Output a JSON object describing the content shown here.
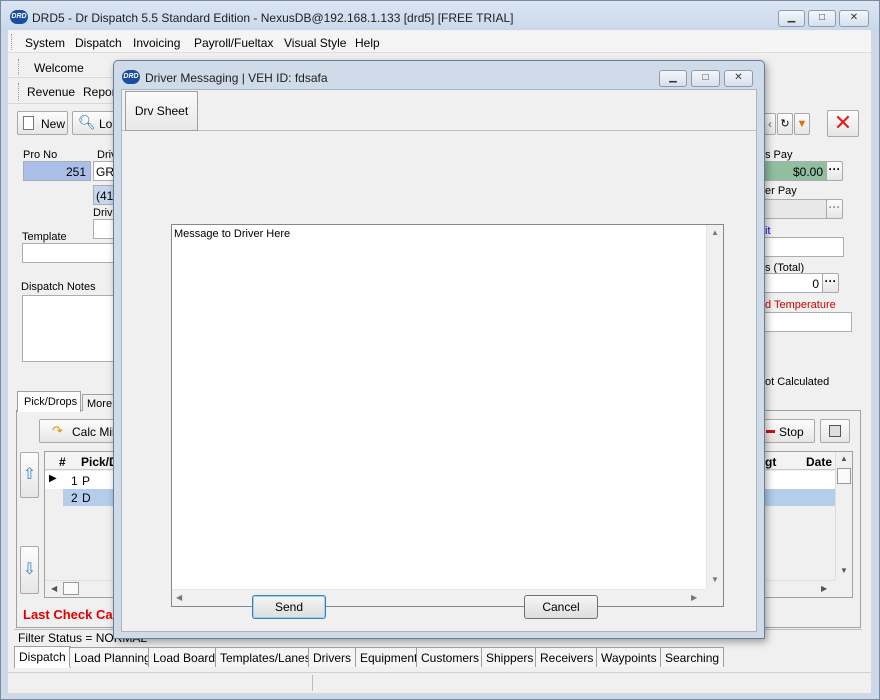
{
  "window": {
    "logo_text": "DRD",
    "title": "DRD5 - Dr Dispatch 5.5 Standard Edition - NexusDB@192.168.1.133 [drd5] [FREE TRIAL]"
  },
  "menu": [
    "System",
    "Dispatch",
    "Invoicing",
    "Payroll/Fueltax",
    "Visual Style",
    "Help"
  ],
  "toolbar": {
    "welcome": "Welcome",
    "revenue": "Revenue",
    "reports": "Repor",
    "new": "New",
    "load": "Lo"
  },
  "form": {
    "pro_no_label": "Pro No",
    "pro_no_value": "251",
    "driver_label": "Driv",
    "driver_value": "GRI",
    "phone_value": "(417",
    "driver2_label": "Drive",
    "template_label": "Template",
    "dispatch_notes_label": "Dispatch Notes",
    "pay_label": "s Pay",
    "pay_value": "$0.00",
    "other_pay_label": "er Pay",
    "unit_label": "it",
    "total_label": "s (Total)",
    "total_value": "0",
    "temp_label": "d Temperature",
    "not_calc": "ot Calculated",
    "last_check": "Last Check Call",
    "filter_status": "Filter Status = NORMAL"
  },
  "subtabs": [
    "Pick/Drops",
    "More..."
  ],
  "grid": {
    "calc_miles": "Calc Miles",
    "stop": "Stop",
    "headers": [
      "#",
      "Pick/D",
      "gt",
      "Date"
    ],
    "rows": [
      {
        "num": "1",
        "type": "P"
      },
      {
        "num": "2",
        "type": "D"
      }
    ]
  },
  "bottom_tabs": [
    "Dispatch",
    "Load Planning",
    "Load Board",
    "Templates/Lanes",
    "Drivers",
    "Equipment",
    "Customers",
    "Shippers",
    "Receivers",
    "Waypoints",
    "Searching"
  ],
  "dialog": {
    "logo_text": "DRD",
    "title": "Driver Messaging | VEH ID: fdsafa",
    "tab": "Drv Sheet",
    "message_text": "Message to Driver Here",
    "send": "Send",
    "cancel": "Cancel"
  },
  "colors": {
    "pro_no_bg": "#a9bfe8",
    "pay_bg": "#8fbf9f",
    "temp_label": "#cc0000",
    "last_check": "#e00000",
    "unit_label": "#0000cc",
    "close_x": "#e02020",
    "row_highlight": "#b3cdea"
  },
  "icons": [
    "minimize-icon",
    "maximize-icon",
    "close-icon",
    "new-doc-icon",
    "search-load-icon",
    "calc-icon",
    "up-arrow-icon",
    "down-arrow-icon",
    "save-icon",
    "refresh-icon",
    "filter-icon"
  ]
}
